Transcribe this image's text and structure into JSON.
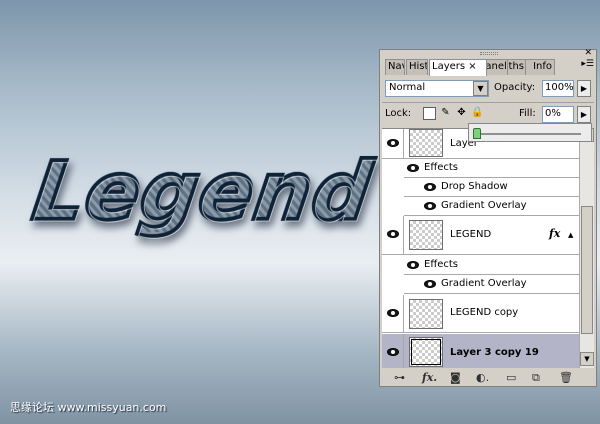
{
  "canvas": {
    "artwork_text": "Legend",
    "watermark": "思缘论坛 www.missyuan.com"
  },
  "panel": {
    "tabs": [
      "Nav",
      "Hist",
      "Layers ×",
      "Chanels",
      "Paths",
      "Info"
    ],
    "active_tab": "Layers ×",
    "blend_mode": "Normal",
    "opacity_label": "Opacity:",
    "opacity_value": "100%",
    "lock_label": "Lock:",
    "fill_label": "Fill:",
    "fill_value": "0%",
    "fill_slider_fraction": 0.0,
    "layers": [
      {
        "name": "Layer",
        "effects_label": "Effects",
        "effects": [
          "Drop Shadow",
          "Gradient Overlay"
        ]
      },
      {
        "name": "LEGEND",
        "fx": "fx",
        "effects_label": "Effects",
        "effects": [
          "Gradient Overlay"
        ]
      },
      {
        "name": "LEGEND copy"
      },
      {
        "name": "Layer 3 copy 19",
        "selected": true
      }
    ]
  },
  "colors": {
    "selected_row": "#b4b4c8",
    "panel_bg": "#d4d0c8"
  }
}
